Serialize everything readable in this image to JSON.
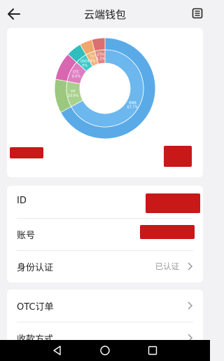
{
  "header": {
    "title": "云端钱包",
    "back_icon": "arrow-left-icon",
    "menu_icon": "list-icon"
  },
  "chart_data": {
    "type": "pie",
    "inner_ring": [
      {
        "label": "BNB",
        "percent": "67.7%",
        "color": "#6cb7ee"
      },
      {
        "label": "HT",
        "percent": "10.9%",
        "color": "#a9d18e"
      },
      {
        "label": "ETC",
        "percent": "9.0%",
        "color": "#e07dc0"
      },
      {
        "label": "USDT",
        "percent": "5%",
        "color": "#3fc9c9"
      },
      {
        "label": "???",
        "percent": "4%",
        "color": "#f2b57e"
      },
      {
        "label": "ETH",
        "percent": "4.3%",
        "color": "#e48282"
      }
    ],
    "outer_ring": [
      {
        "percent": 67.7,
        "color": "#5aaae8"
      },
      {
        "percent": 10.9,
        "color": "#9cc77f"
      },
      {
        "percent": 9.0,
        "color": "#d966b1"
      },
      {
        "percent": 5.0,
        "color": "#2fbdbd"
      },
      {
        "percent": 4.0,
        "color": "#efa86b"
      },
      {
        "percent": 4.3,
        "color": "#dc6f6f"
      }
    ]
  },
  "info": {
    "id_label": "ID",
    "account_label": "账号",
    "identity_label": "身份认证",
    "identity_value": "已认证"
  },
  "otc": {
    "orders_label": "OTC订单",
    "payment_label": "收款方式"
  },
  "colors": {
    "background": "#f2f2f4",
    "card": "#ffffff",
    "redaction": "#c81818"
  }
}
